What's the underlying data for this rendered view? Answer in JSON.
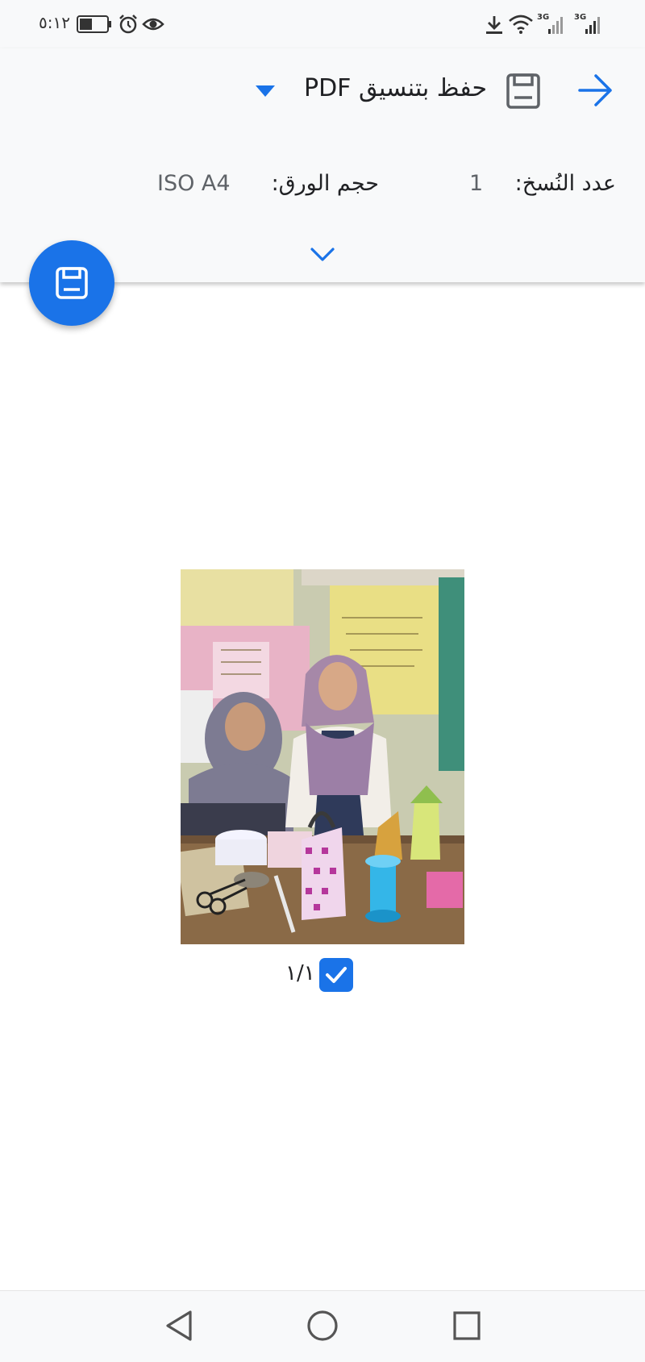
{
  "status_bar": {
    "time": "٥:١٢",
    "network_type_1": "3G",
    "network_type_2": "3G",
    "icons": [
      "battery-icon",
      "alarm-icon",
      "eye-icon",
      "download-icon",
      "wifi-icon",
      "signal-icon",
      "signal-icon"
    ]
  },
  "header": {
    "destination": "حفظ بتنسيق PDF",
    "copies_label": "عدد النُسخ:",
    "copies_value": "1",
    "paper_label": "حجم الورق:",
    "paper_value": "ISO A4"
  },
  "preview": {
    "page_number": "١/١",
    "selected": true
  },
  "colors": {
    "accent": "#1a73e8",
    "panel_bg": "#f8f9fa",
    "text": "#202124",
    "secondary_text": "#5f6368"
  },
  "icons": {
    "dropdown": "triangle-down-icon",
    "dest": "save-icon",
    "forward": "arrow-right-icon",
    "expand": "chevron-down-icon",
    "fab": "save-pdf-icon",
    "nav": [
      "back-icon",
      "home-icon",
      "recents-icon"
    ]
  }
}
